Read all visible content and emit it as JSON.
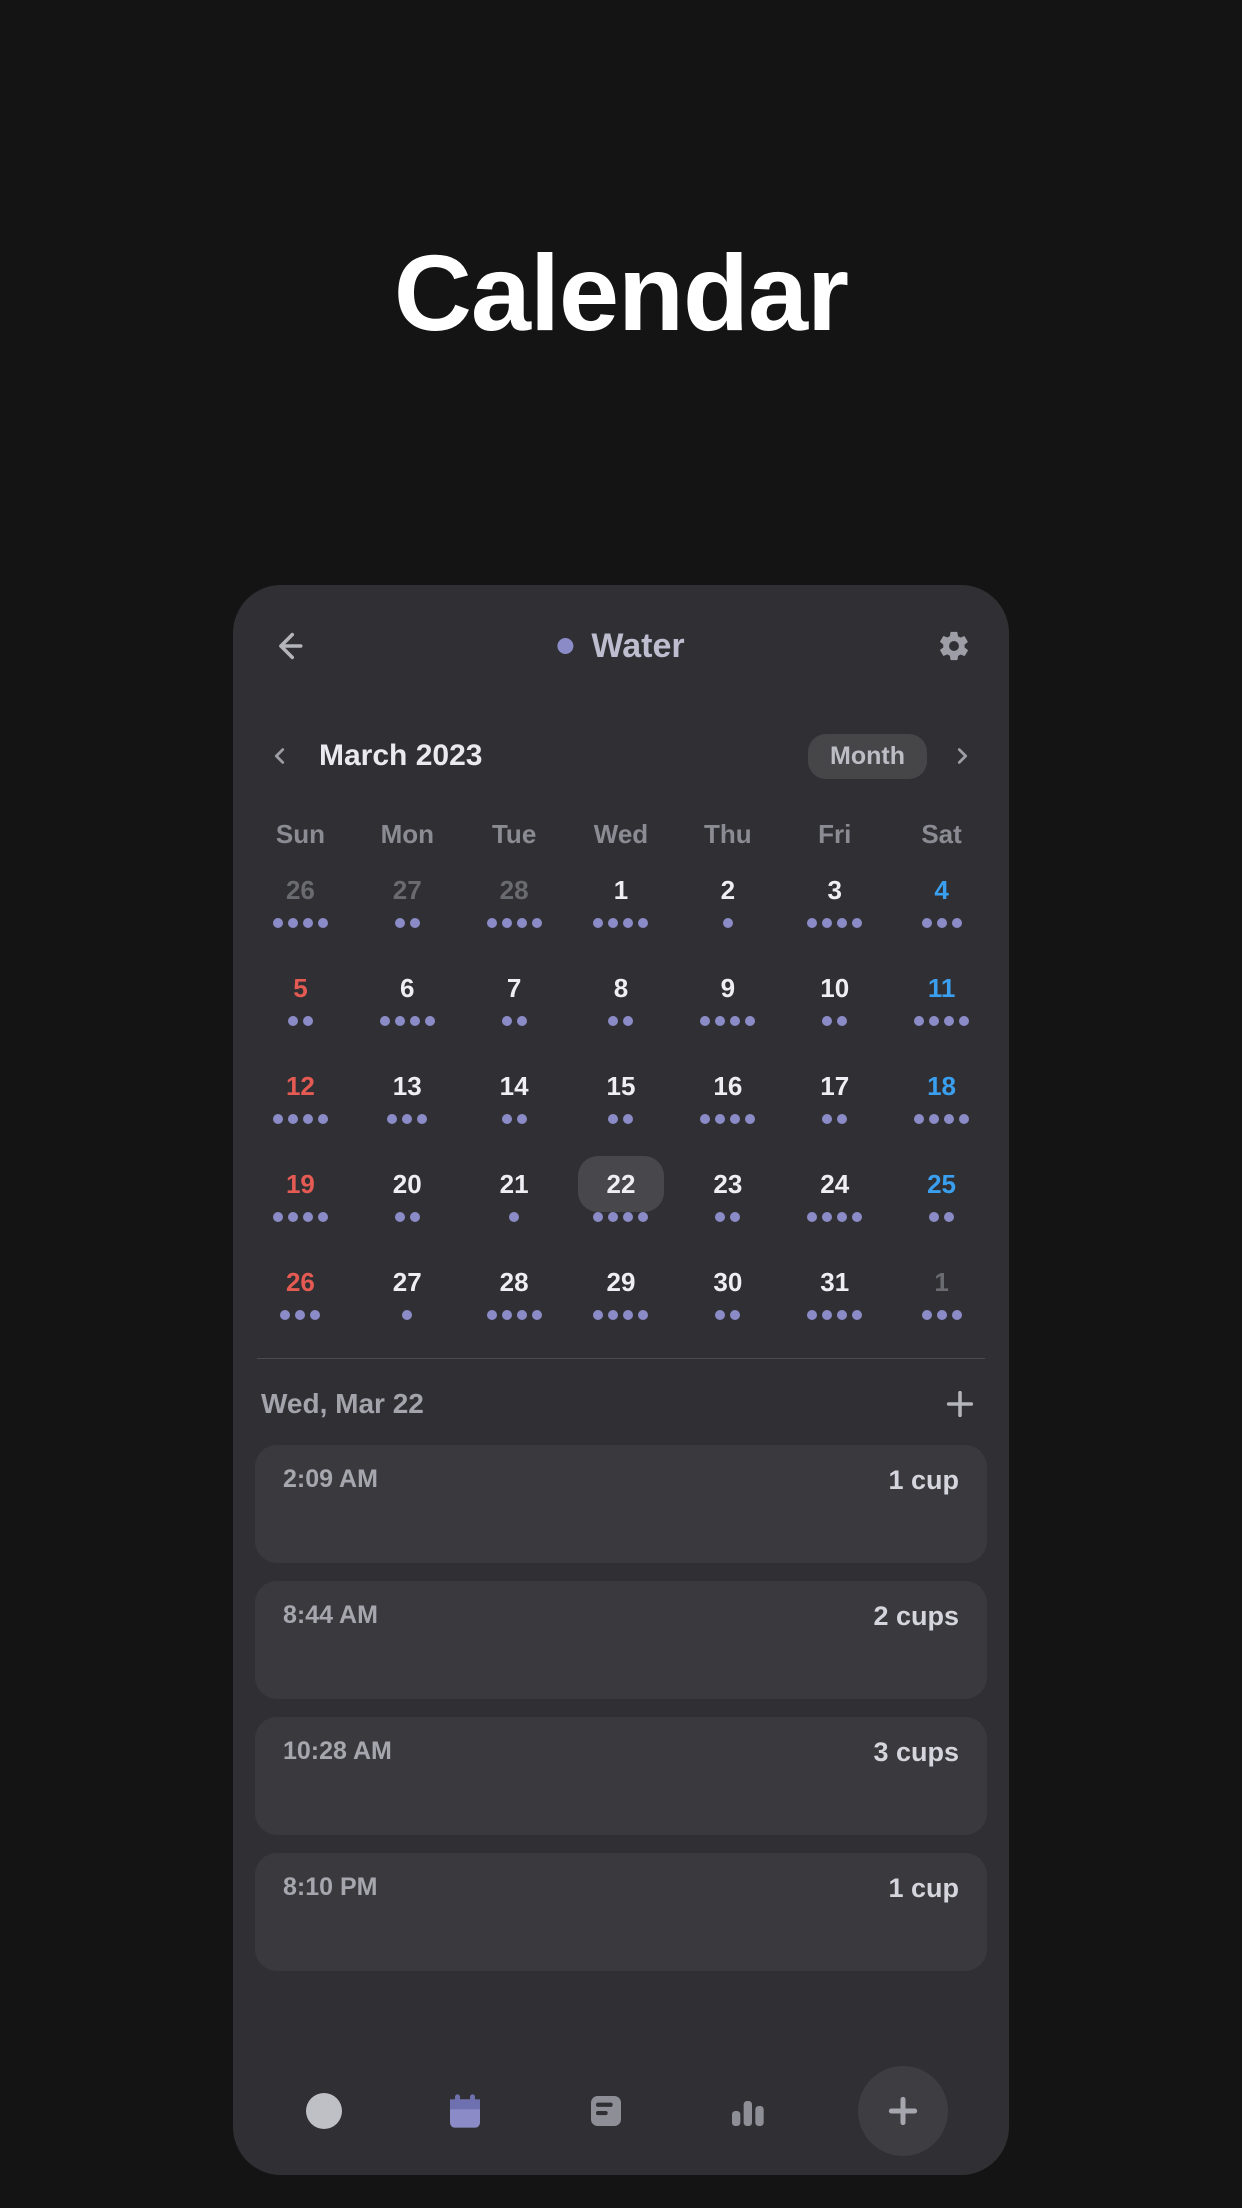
{
  "page_title": "Calendar",
  "header": {
    "title": "Water"
  },
  "month": {
    "label": "March 2023",
    "view_pill": "Month"
  },
  "weekdays": [
    "Sun",
    "Mon",
    "Tue",
    "Wed",
    "Thu",
    "Fri",
    "Sat"
  ],
  "cells": [
    {
      "n": "26",
      "cls": "dim",
      "d": 4
    },
    {
      "n": "27",
      "cls": "dim",
      "d": 2
    },
    {
      "n": "28",
      "cls": "dim",
      "d": 4
    },
    {
      "n": "1",
      "cls": "",
      "d": 4
    },
    {
      "n": "2",
      "cls": "",
      "d": 1
    },
    {
      "n": "3",
      "cls": "",
      "d": 4
    },
    {
      "n": "4",
      "cls": "sat",
      "d": 3
    },
    {
      "n": "5",
      "cls": "sun",
      "d": 2
    },
    {
      "n": "6",
      "cls": "",
      "d": 4
    },
    {
      "n": "7",
      "cls": "",
      "d": 2
    },
    {
      "n": "8",
      "cls": "",
      "d": 2
    },
    {
      "n": "9",
      "cls": "",
      "d": 4
    },
    {
      "n": "10",
      "cls": "",
      "d": 2
    },
    {
      "n": "11",
      "cls": "sat",
      "d": 4
    },
    {
      "n": "12",
      "cls": "sun",
      "d": 4
    },
    {
      "n": "13",
      "cls": "",
      "d": 3
    },
    {
      "n": "14",
      "cls": "",
      "d": 2
    },
    {
      "n": "15",
      "cls": "",
      "d": 2
    },
    {
      "n": "16",
      "cls": "",
      "d": 4
    },
    {
      "n": "17",
      "cls": "",
      "d": 2
    },
    {
      "n": "18",
      "cls": "sat",
      "d": 4
    },
    {
      "n": "19",
      "cls": "sun",
      "d": 4
    },
    {
      "n": "20",
      "cls": "",
      "d": 2
    },
    {
      "n": "21",
      "cls": "",
      "d": 1
    },
    {
      "n": "22",
      "cls": "sel",
      "d": 4
    },
    {
      "n": "23",
      "cls": "",
      "d": 2
    },
    {
      "n": "24",
      "cls": "",
      "d": 4
    },
    {
      "n": "25",
      "cls": "sat",
      "d": 2
    },
    {
      "n": "26",
      "cls": "sun",
      "d": 3
    },
    {
      "n": "27",
      "cls": "",
      "d": 1
    },
    {
      "n": "28",
      "cls": "",
      "d": 4
    },
    {
      "n": "29",
      "cls": "",
      "d": 4
    },
    {
      "n": "30",
      "cls": "",
      "d": 2
    },
    {
      "n": "31",
      "cls": "",
      "d": 4
    },
    {
      "n": "1",
      "cls": "dim",
      "d": 3
    }
  ],
  "selected_date": "Wed, Mar 22",
  "entries": [
    {
      "time": "2:09 AM",
      "value": "1 cup"
    },
    {
      "time": "8:44 AM",
      "value": "2 cups"
    },
    {
      "time": "10:28 AM",
      "value": "3 cups"
    },
    {
      "time": "8:10 PM",
      "value": "1 cup"
    }
  ]
}
